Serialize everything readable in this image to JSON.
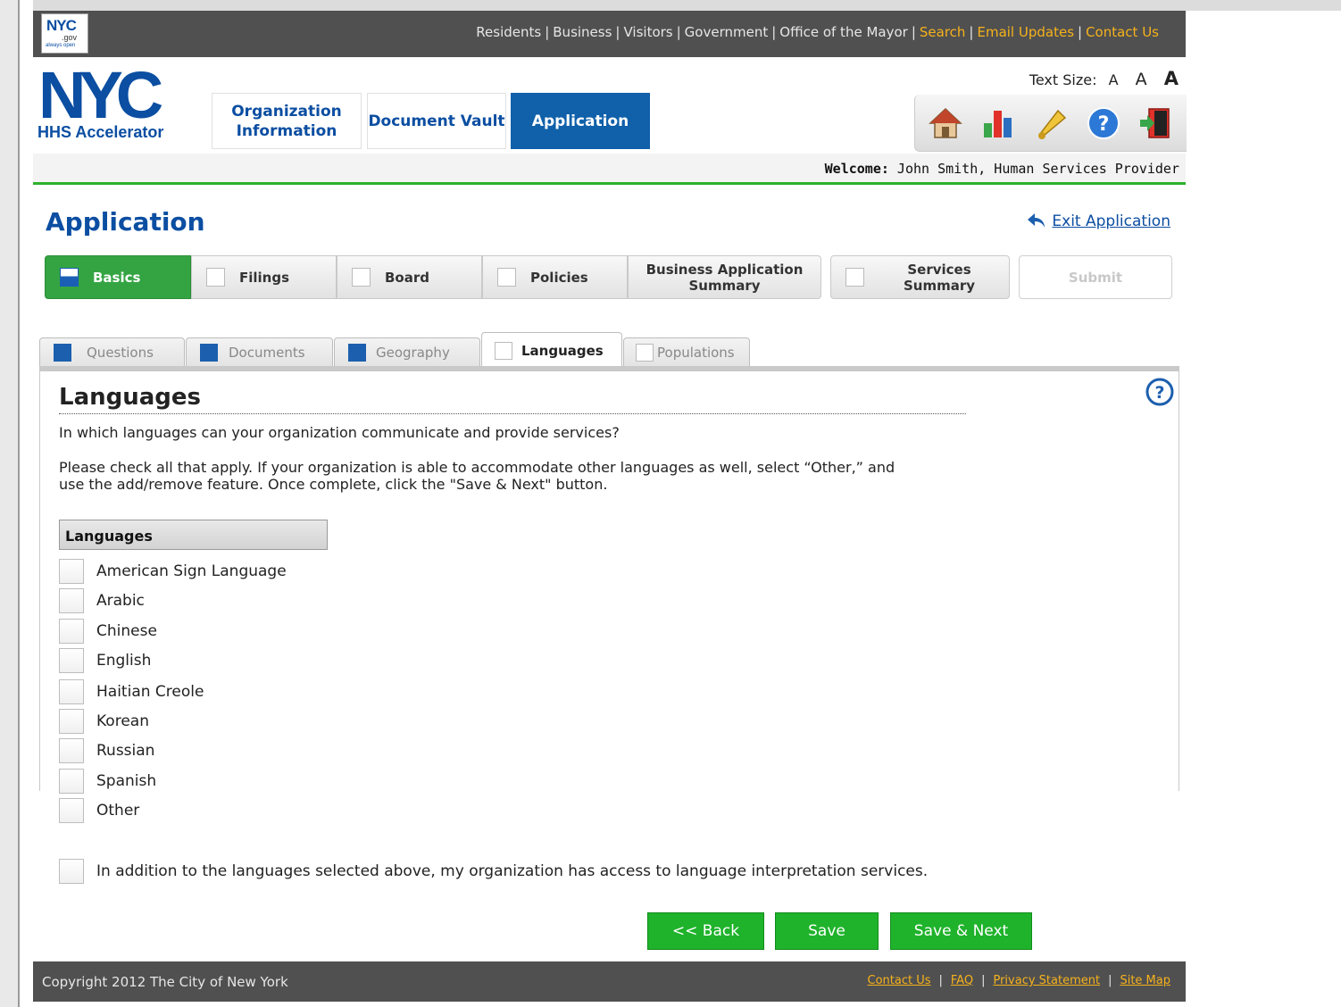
{
  "top_bar": {
    "logo": {
      "text": "NYC",
      "sub": ".gov",
      "tagline": "always open"
    },
    "links": [
      {
        "label": "Residents",
        "highlight": false
      },
      {
        "label": "Business",
        "highlight": false
      },
      {
        "label": "Visitors",
        "highlight": false
      },
      {
        "label": "Government",
        "highlight": false
      },
      {
        "label": "Office of the Mayor",
        "highlight": false
      },
      {
        "label": "Search",
        "highlight": true
      },
      {
        "label": "Email Updates",
        "highlight": true
      },
      {
        "label": "Contact Us",
        "highlight": true
      }
    ]
  },
  "header": {
    "logo_text": "NYC",
    "logo_subtitle": "HHS Accelerator",
    "nav_tabs": [
      {
        "label": "Organization Information",
        "active": false
      },
      {
        "label": "Document Vault",
        "active": false
      },
      {
        "label": "Application",
        "active": true
      }
    ],
    "text_size": {
      "label": "Text Size:",
      "small": "A",
      "medium": "A",
      "large": "A"
    },
    "icons": [
      "home-icon",
      "bar-chart-icon",
      "bell-icon",
      "help-icon",
      "logout-icon"
    ],
    "welcome_label": "Welcome:",
    "welcome_user": "John Smith, Human Services Provider"
  },
  "page": {
    "title": "Application",
    "exit_link": "Exit Application"
  },
  "steps": [
    {
      "label": "Basics",
      "state": "active"
    },
    {
      "label": "Filings",
      "state": "normal"
    },
    {
      "label": "Board",
      "state": "normal"
    },
    {
      "label": "Policies",
      "state": "normal"
    },
    {
      "label": "Business Application Summary",
      "state": "nobox"
    },
    {
      "label": "Services Summary",
      "state": "normal"
    },
    {
      "label": "Submit",
      "state": "disabled"
    }
  ],
  "subtabs": [
    {
      "label": "Questions",
      "complete": true
    },
    {
      "label": "Documents",
      "complete": true
    },
    {
      "label": "Geography",
      "complete": true
    },
    {
      "label": "Languages",
      "complete": false,
      "active": true
    },
    {
      "label": "Populations",
      "complete": false
    }
  ],
  "section": {
    "title": "Languages",
    "question": "In which languages can your organization communicate and provide services?",
    "instructions": "Please check all that apply. If your organization is able to accommodate other languages as well, select “Other,” and use the add/remove feature. Once complete, click the \"Save & Next\" button.",
    "list_header": "Languages",
    "languages": [
      "American Sign Language",
      "Arabic",
      "Chinese",
      "English",
      "Haitian Creole",
      "Korean",
      "Russian",
      "Spanish",
      "Other"
    ],
    "interpretation_label": "In addition to the languages selected above, my organization has access to language interpretation services."
  },
  "buttons": {
    "back": "<< Back",
    "save": "Save",
    "save_next": "Save & Next"
  },
  "footer": {
    "copyright": "Copyright 2012 The City of New York",
    "links": [
      "Contact Us",
      "FAQ",
      "Privacy Statement",
      "Site Map"
    ]
  },
  "colors": {
    "brand_blue": "#0b4ea2",
    "active_tab": "#1060aa",
    "green": "#1fb32b",
    "top_bar": "#505050",
    "highlight_link": "#f6b21b"
  }
}
